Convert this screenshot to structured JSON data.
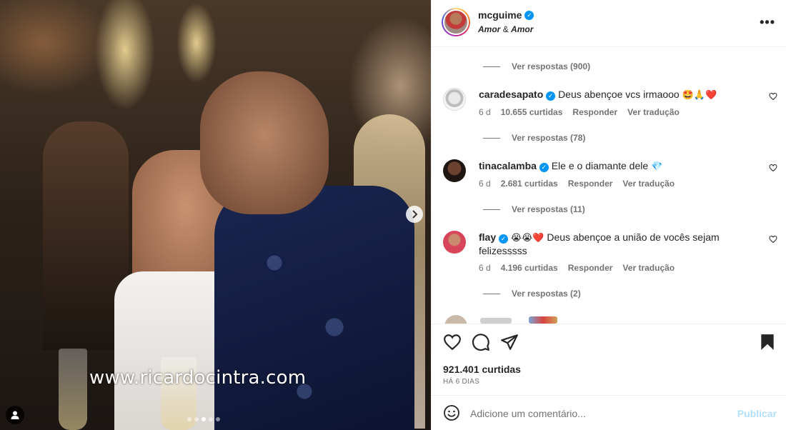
{
  "photo": {
    "watermark": "www.ricardocintra.com",
    "carousel_dots": 5,
    "active_dot": 2
  },
  "post": {
    "username": "mcguime",
    "subtitle_a": "Amor",
    "subtitle_sep": "&",
    "subtitle_b": "Amor",
    "more_label": "•••"
  },
  "comments": {
    "replies_top": "Ver respostas (900)",
    "items": [
      {
        "username": "caradesapato",
        "text": "Deus abençoe vcs irmaooo",
        "emojis": "🤩🙏❤️",
        "age": "6 d",
        "likes": "10.655 curtidas",
        "reply": "Responder",
        "translate": "Ver tradução",
        "replies": "Ver respostas (78)"
      },
      {
        "username": "tinacalamba",
        "text": "Ele e o diamante dele",
        "emojis": "💎",
        "age": "6 d",
        "likes": "2.681 curtidas",
        "reply": "Responder",
        "translate": "Ver tradução",
        "replies": "Ver respostas (11)"
      },
      {
        "username": "flay",
        "emojis": "😭😭❤️",
        "text": "Deus abençoe a união de vocês sejam felizesssss",
        "age": "6 d",
        "likes": "4.196 curtidas",
        "reply": "Responder",
        "translate": "Ver tradução",
        "replies": "Ver respostas (2)"
      }
    ]
  },
  "footer": {
    "likes": "921.401 curtidas",
    "time_ago": "HÁ 6 DIAS",
    "comment_placeholder": "Adicione um comentário...",
    "publish": "Publicar"
  },
  "colors": {
    "verified": "#0095f6",
    "muted": "#737373",
    "publish_disabled": "#b3dffc"
  }
}
